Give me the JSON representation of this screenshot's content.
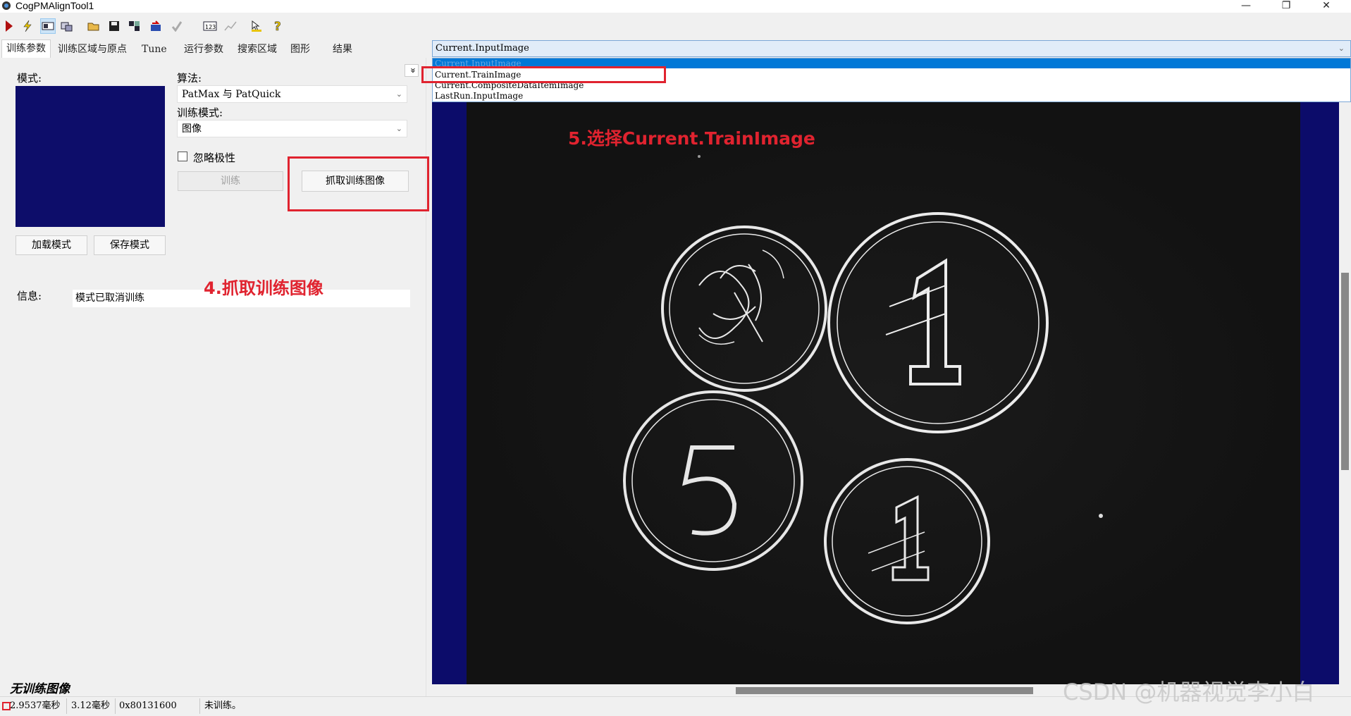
{
  "window": {
    "title": "CogPMAlignTool1",
    "minimize": "—",
    "restore": "❐",
    "close": "✕"
  },
  "toolbar": {
    "icons": [
      "run-icon",
      "lightning-icon",
      "show-icon",
      "camera-icon",
      "open-icon",
      "save-icon",
      "grid-icon",
      "reset-icon",
      "check-icon",
      "numeric-icon",
      "graph-icon",
      "cursor-icon",
      "help-icon"
    ]
  },
  "tabs": [
    "训练参数",
    "训练区域与原点",
    "Tune",
    "运行参数",
    "搜索区域",
    "图形",
    "结果"
  ],
  "left": {
    "pattern_label": "模式:",
    "algorithm_label": "算法:",
    "algorithm_value": "PatMax 与 PatQuick",
    "train_mode_label": "训练模式:",
    "train_mode_value": "图像",
    "ignore_polarity_label": "忽略极性",
    "train_button": "训练",
    "grab_button": "抓取训练图像",
    "load_button": "加载模式",
    "save_button": "保存模式",
    "info_label": "信息:",
    "info_value": "模式已取消训练",
    "no_train_image": "无训练图像",
    "expand_icon": "»"
  },
  "annotations": {
    "step4": "4.抓取训练图像",
    "step5": "5.选择Current.TrainImage"
  },
  "image_source": {
    "selected": "Current.InputImage",
    "options": [
      "Current.InputImage",
      "Current.TrainImage",
      "Current.CompositeDataItemImage",
      "LastRun.InputImage"
    ]
  },
  "status": {
    "time1": "2.9537毫秒",
    "time2": "3.12毫秒",
    "address": "0x80131600",
    "message": "未训练。"
  },
  "watermark": "CSDN @机器视觉李小白",
  "colors": {
    "annotation": "#e0232f",
    "pattern_bg": "#0d0d6a",
    "image_border": "#0c0c6a"
  }
}
